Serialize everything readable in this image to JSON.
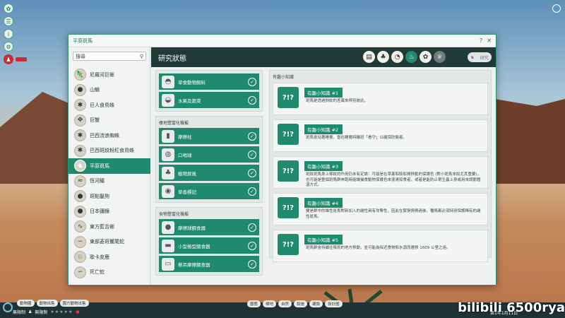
{
  "window": {
    "title": "平原斑馬",
    "help": "?",
    "close": "✕"
  },
  "search": {
    "placeholder": "搜尋",
    "icon": "search-icon"
  },
  "animals": [
    {
      "label": "尼羅河巨蜥",
      "icon": "lizard-icon",
      "active": false
    },
    {
      "label": "山魈",
      "icon": "mandrill-icon",
      "active": false
    },
    {
      "label": "巨人食鳥蛛",
      "icon": "spider-icon",
      "active": false
    },
    {
      "label": "巨蟹",
      "icon": "crab-icon",
      "active": false
    },
    {
      "label": "巴西流浪蜘蛛",
      "icon": "spider-icon",
      "active": false
    },
    {
      "label": "巴西斑紋粉紅食鳥蛛",
      "icon": "spider-icon",
      "active": false
    },
    {
      "label": "平原斑馬",
      "icon": "zebra-icon",
      "active": true
    },
    {
      "label": "恆河鱷",
      "icon": "gharial-icon",
      "active": false
    },
    {
      "label": "斑點鬣狗",
      "icon": "hyena-icon",
      "active": false
    },
    {
      "label": "日本彌猴",
      "icon": "macaque-icon",
      "active": false
    },
    {
      "label": "東方藍舌蜥",
      "icon": "skink-icon",
      "active": false
    },
    {
      "label": "東部菱斑響尾蛇",
      "icon": "snake-icon",
      "active": false
    },
    {
      "label": "歌卡皮鹿",
      "icon": "okapi-icon",
      "active": false
    },
    {
      "label": "死亡蛇",
      "icon": "snake-icon",
      "active": false
    }
  ],
  "main": {
    "heading": "研究狀態",
    "tabs": [
      {
        "name": "tab-research",
        "glyph": "▤",
        "state": "normal"
      },
      {
        "name": "tab-habitat",
        "glyph": "♣",
        "state": "normal"
      },
      {
        "name": "tab-food",
        "glyph": "◔",
        "state": "normal"
      },
      {
        "name": "tab-enrichment",
        "glyph": "♨",
        "state": "active"
      },
      {
        "name": "tab-animal",
        "glyph": "✿",
        "state": "normal"
      },
      {
        "name": "tab-trophy",
        "glyph": "♛",
        "state": "dim"
      }
    ],
    "top_right": "研究"
  },
  "research": {
    "group1": {
      "title": "",
      "items": [
        {
          "label": "草食動物飼料",
          "icon": "feed-bowl-icon"
        },
        {
          "label": "水果及蔬菜",
          "icon": "food-bowl-icon"
        }
      ]
    },
    "group2": {
      "title": "棲地豐富化機擬",
      "items": [
        {
          "label": "摩擦柱",
          "icon": "scratch-post-icon"
        },
        {
          "label": "口哨球",
          "icon": "whistle-ball-icon"
        },
        {
          "label": "植物屏風",
          "icon": "plant-screen-icon"
        },
        {
          "label": "草香標記",
          "icon": "scent-marker-icon"
        }
      ]
    },
    "group3": {
      "title": "食物豐富化機擬",
      "items": [
        {
          "label": "摩擦球餵食器",
          "icon": "ball-feeder-icon"
        },
        {
          "label": "小型樁型餵食器",
          "icon": "log-feeder-icon"
        },
        {
          "label": "懸吊摩擦餵食器",
          "icon": "hanging-feeder-icon"
        }
      ]
    }
  },
  "facts": {
    "title": "有趣小知識",
    "items": [
      {
        "tag": "有趣小知識 #1",
        "text": "斑馬是透過斜紋的差異來辨別彼此。"
      },
      {
        "tag": "有趣小知識 #2",
        "text": "斑馬會站著睡覺，當在睡覺時輪班「看守」以確保防衛者。"
      },
      {
        "tag": "有趣小知識 #3",
        "text": "斑紋斑馬身上條紋的作用仍未有定論：可能是在草叢和陰影間移動的保護色 (對小斑馬來說尤其重要)，也可能是整個斑馬群奔跑時能讓捕食動物保護色來混淆掠食者，或者是能防止寄生蟲上身或用來調節體溫方式。"
      },
      {
        "tag": "有趣小知識 #4",
        "text": "要是群中的雄性斑馬對新加入的雌性具有攻擊性，因此在緊張情勢過後，種馬都必須特別保護稀有的雌性斑馬。"
      },
      {
        "tag": "有趣小知識 #5",
        "text": "斑馬群會持續往降雨的地方移動，並可能為採近食物和水源而遷移 1609 公里之遠。"
      }
    ]
  },
  "bottom": {
    "upper_pills": [
      "動物園",
      "動物出售",
      "園方動物出售"
    ],
    "center_pills": [
      "園藝",
      "棲地",
      "自然",
      "設施",
      "建設",
      "設計圖"
    ],
    "lower": {
      "money": "無限制",
      "guests": "無限制",
      "stars": "★★★★★"
    },
    "date": "第1年1月11日",
    "watermark": "bilibili 6500rya"
  }
}
